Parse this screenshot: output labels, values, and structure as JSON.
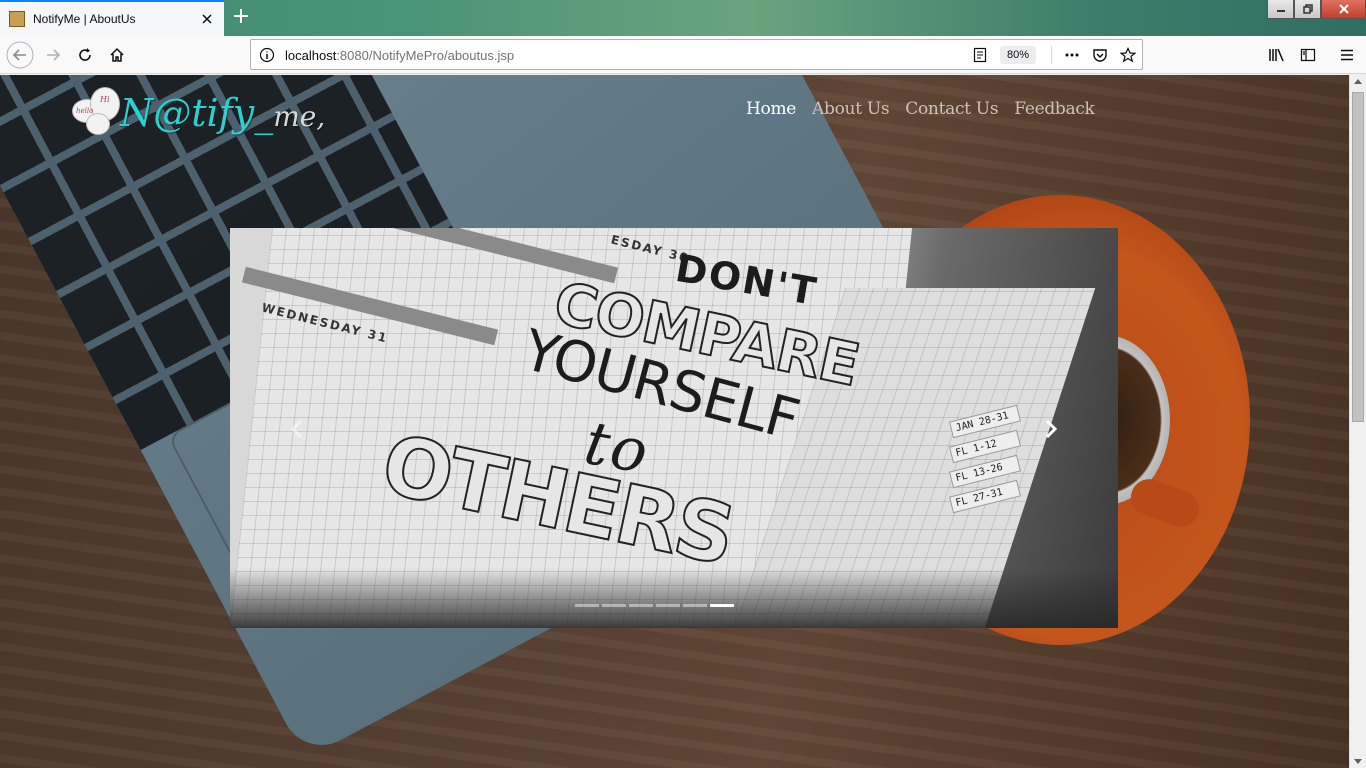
{
  "browser": {
    "tab_title": "NotifyMe | AboutUs",
    "url_host": "localhost",
    "url_rest": ":8080/NotifyMePro/aboutus.jsp",
    "zoom": "80%"
  },
  "site": {
    "logo_text": "N@tify_",
    "logo_suffix": "me,",
    "bubble_text_a": "hello",
    "bubble_text_b": "Hi",
    "nav": [
      {
        "label": "Home",
        "active": true
      },
      {
        "label": "About Us",
        "active": false
      },
      {
        "label": "Contact Us",
        "active": false
      },
      {
        "label": "Feedback",
        "active": false
      }
    ]
  },
  "carousel": {
    "slide_text": {
      "line1": "DON'T",
      "line2": "COMPARE",
      "line3": "YOURSELF",
      "line4": "to",
      "line5": "OTHERS",
      "note_a": "WEDNESDAY 31",
      "note_b": "ESDAY 30",
      "tabs": [
        "JAN 28-31",
        "FL 1-12",
        "FL 13-26",
        "FL 27-31"
      ]
    },
    "slide_count": 6,
    "active_slide": 6,
    "prev_icon": "chevron-left-icon",
    "next_icon": "chevron-right-icon"
  }
}
